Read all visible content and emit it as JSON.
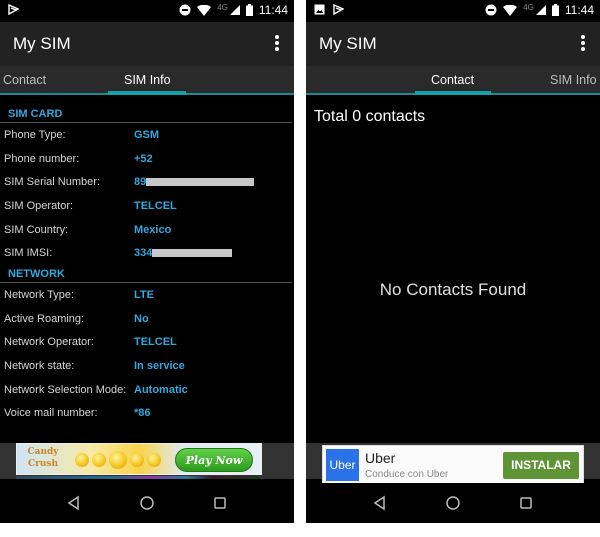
{
  "status_bar": {
    "time": "11:44",
    "network_label": "4G",
    "left_icons_left_phone": [
      "notification-flag-icon"
    ],
    "left_icons_right_phone": [
      "image-icon",
      "notification-flag-icon"
    ],
    "right_icons": [
      "do-not-disturb-icon",
      "wifi-icon",
      "signal-icon",
      "battery-icon"
    ]
  },
  "app": {
    "title": "My SIM",
    "menu_icon": "overflow-menu-icon"
  },
  "tabs": [
    {
      "label": "Contact"
    },
    {
      "label": "SIM Info"
    }
  ],
  "left_screen": {
    "active_tab": "SIM Info",
    "sections": [
      {
        "title": "SIM CARD",
        "rows": [
          {
            "label": "Phone Type:",
            "value": "GSM",
            "redacted": false
          },
          {
            "label": "Phone number:",
            "value": "+52",
            "redacted": false
          },
          {
            "label": "SIM Serial Number:",
            "value": "89",
            "redacted": true
          },
          {
            "label": "SIM Operator:",
            "value": "TELCEL",
            "redacted": false
          },
          {
            "label": "SIM Country:",
            "value": "Mexico",
            "redacted": false
          },
          {
            "label": "SIM IMSI:",
            "value": "334",
            "redacted": true
          }
        ]
      },
      {
        "title": "NETWORK",
        "rows": [
          {
            "label": "Network Type:",
            "value": "LTE"
          },
          {
            "label": "Active Roaming:",
            "value": "No"
          },
          {
            "label": "Network Operator:",
            "value": "TELCEL"
          },
          {
            "label": "Network state:",
            "value": "In service"
          },
          {
            "label": "Network Selection Mode:",
            "value": "Automatic"
          },
          {
            "label": "Voice mail number:",
            "value": "*86"
          }
        ]
      }
    ],
    "ad": {
      "brand": "Candy Crush Saga",
      "logo_text": "Candy Crush",
      "button_label": "Play Now"
    }
  },
  "right_screen": {
    "active_tab": "Contact",
    "total_text": "Total 0 contacts",
    "empty_text": "No Contacts Found",
    "ad": {
      "logo_text": "Uber",
      "title": "Uber",
      "subtitle": "Conduce con Uber",
      "button_label": "INSTALAR"
    }
  },
  "colors": {
    "accent_teal": "#14a0a8",
    "value_blue": "#31a8e0",
    "app_bar": "#222222",
    "install_green": "#5f9436",
    "uber_blue": "#2a72e8"
  },
  "nav_bar": [
    "back-icon",
    "home-icon",
    "recents-icon"
  ]
}
